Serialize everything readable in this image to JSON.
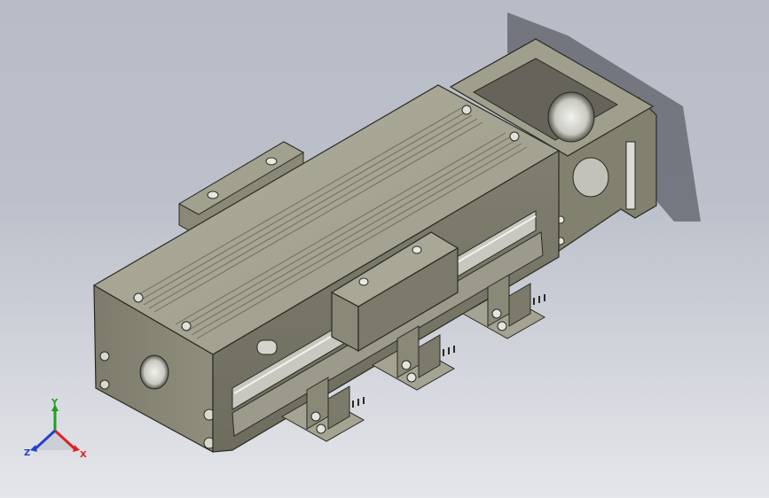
{
  "triad": {
    "x_label": "X",
    "y_label": "Y",
    "z_label": "Z",
    "x_color": "#e02020",
    "y_color": "#20a020",
    "z_color": "#2040d0"
  },
  "model": {
    "body_color": "#8c8a78",
    "top_color": "#a7a593",
    "side_color": "#6f6d5e",
    "edge_color": "#2a2a24",
    "screw_color": "#d8d8d0"
  }
}
